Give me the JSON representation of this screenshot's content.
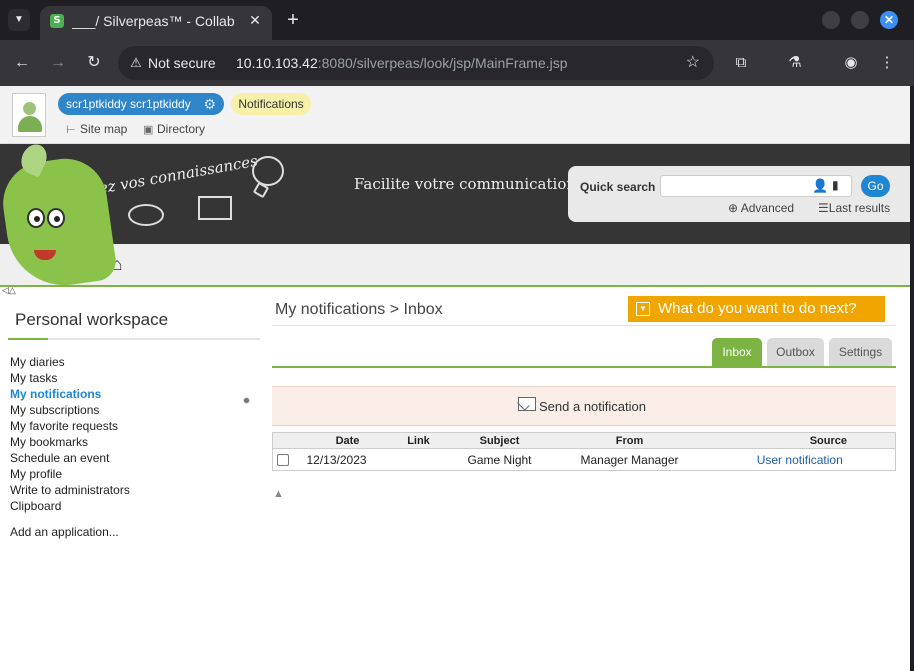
{
  "browser": {
    "tab_title": "___/ Silverpeas™ - Collab",
    "not_secure": "Not secure",
    "url_host": "10.10.103.42",
    "url_rest": ":8080/silverpeas/look/jsp/MainFrame.jsp",
    "favicon_letter": "S"
  },
  "userbar": {
    "username": "scr1ptkiddy scr1ptkiddy",
    "notifications": "Notifications",
    "site_map": "Site map",
    "directory": "Directory"
  },
  "banner": {
    "slogan_left": "Partagez vos connaissances",
    "slogan_right": "Facilite votre communication",
    "quick_search_label": "Quick search",
    "go": "Go",
    "advanced": "Advanced",
    "last_results": "Last results"
  },
  "sidebar": {
    "title": "Personal workspace",
    "items": [
      {
        "label": "My diaries"
      },
      {
        "label": "My tasks"
      },
      {
        "label": "My notifications"
      },
      {
        "label": "My subscriptions"
      },
      {
        "label": "My favorite requests"
      },
      {
        "label": "My bookmarks"
      },
      {
        "label": "Schedule an event"
      },
      {
        "label": "My profile"
      },
      {
        "label": "Write to administrators"
      },
      {
        "label": "Clipboard"
      }
    ],
    "add_app": "Add an application..."
  },
  "main": {
    "crumb_root": "My notifications",
    "crumb_sep": ">",
    "crumb_current": "Inbox",
    "what_next": "What do you want to do next?",
    "tabs": [
      {
        "label": "Inbox"
      },
      {
        "label": "Outbox"
      },
      {
        "label": "Settings"
      }
    ],
    "send_notification": "Send a notification",
    "columns": [
      "Date",
      "Link",
      "Subject",
      "From",
      "Source"
    ],
    "rows": [
      {
        "date": "12/13/2023",
        "link": "",
        "subject": "Game Night",
        "from": "Manager Manager",
        "source": "User notification"
      }
    ]
  },
  "colors": {
    "accent_green": "#7cb342",
    "brand_blue": "#1e86d2",
    "cta_orange": "#f0a500",
    "banner_dark": "#353535"
  },
  "icons": [
    "chevron-down-icon",
    "close-icon",
    "plus-icon",
    "back-arrow-icon",
    "forward-arrow-icon",
    "reload-icon",
    "warning-icon",
    "star-icon",
    "extension-icon",
    "lab-flask-icon",
    "profile-icon",
    "kebab-menu-icon",
    "gear-icon",
    "sitemap-icon",
    "directory-icon",
    "home-icon",
    "person-icon",
    "document-icon",
    "advanced-search-icon",
    "list-icon",
    "mail-icon",
    "arrow-up-icon"
  ]
}
